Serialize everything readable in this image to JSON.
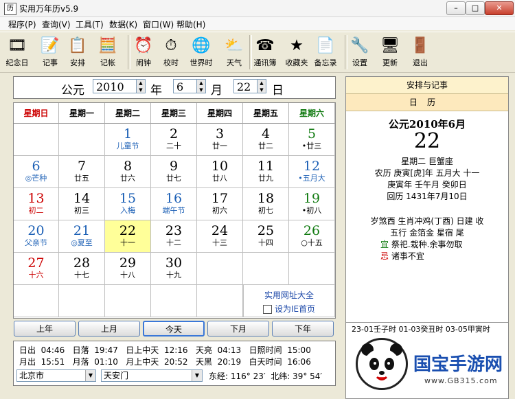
{
  "window": {
    "title": "实用万年历v5.9",
    "icon": "calendar-app-icon",
    "min": "–",
    "max": "□",
    "close": "✕"
  },
  "menu": [
    "程序(P)",
    "查询(V)",
    "工具(T)",
    "数据(K)",
    "窗口(W)",
    "帮助(H)"
  ],
  "toolbar": [
    {
      "label": "纪念日",
      "icon": "film-icon",
      "glyph": "🎞"
    },
    {
      "label": "记事",
      "icon": "notebook-pen-icon",
      "glyph": "📝"
    },
    {
      "label": "安排",
      "icon": "clipboard-icon",
      "glyph": "📋"
    },
    {
      "label": "记帐",
      "icon": "calculator-icon",
      "glyph": "🧮"
    },
    {
      "label": "闹钟",
      "icon": "alarm-clock-icon",
      "glyph": "⏰"
    },
    {
      "label": "校时",
      "icon": "stopwatch-icon",
      "glyph": "⏱"
    },
    {
      "label": "世界时",
      "icon": "globe-icon",
      "glyph": "🌐"
    },
    {
      "label": "天气",
      "icon": "weather-icon",
      "glyph": "⛅"
    },
    {
      "label": "通讯簿",
      "icon": "phone-icon",
      "glyph": "☎"
    },
    {
      "label": "收藏夹",
      "icon": "star-icon",
      "glyph": "★"
    },
    {
      "label": "备忘录",
      "icon": "memo-icon",
      "glyph": "📄"
    },
    {
      "label": "设置",
      "icon": "tools-icon",
      "glyph": "🔧"
    },
    {
      "label": "更新",
      "icon": "update-icon",
      "glyph": "🖥"
    },
    {
      "label": "退出",
      "icon": "exit-door-icon",
      "glyph": "🚪"
    }
  ],
  "date_selector": {
    "era": "公元",
    "year": "2010",
    "year_unit": "年",
    "month": "6",
    "month_unit": "月",
    "day": "22",
    "day_unit": "日"
  },
  "calendar": {
    "weekdays": [
      "星期日",
      "星期一",
      "星期二",
      "星期三",
      "星期四",
      "星期五",
      "星期六"
    ],
    "weekday_colors": [
      "#cc0000",
      "#000000",
      "#000000",
      "#000000",
      "#000000",
      "#000000",
      "#107a10"
    ],
    "rows": [
      [
        null,
        null,
        {
          "d": "1",
          "s": "儿童节",
          "c": "c-blu",
          "sc": "c-blu"
        },
        {
          "d": "2",
          "s": "二十",
          "c": "c-blk"
        },
        {
          "d": "3",
          "s": "廿一",
          "c": "c-blk"
        },
        {
          "d": "4",
          "s": "廿二",
          "c": "c-blk"
        },
        {
          "d": "5",
          "s": "•廿三",
          "c": "c-grn"
        }
      ],
      [
        {
          "d": "6",
          "s": "◎芒种",
          "c": "c-blu",
          "sc": "c-blu"
        },
        {
          "d": "7",
          "s": "廿五",
          "c": "c-blk"
        },
        {
          "d": "8",
          "s": "廿六",
          "c": "c-blk"
        },
        {
          "d": "9",
          "s": "廿七",
          "c": "c-blk"
        },
        {
          "d": "10",
          "s": "廿八",
          "c": "c-blk"
        },
        {
          "d": "11",
          "s": "廿九",
          "c": "c-blk"
        },
        {
          "d": "12",
          "s": "•五月大",
          "c": "c-blu",
          "sc": "c-blu"
        }
      ],
      [
        {
          "d": "13",
          "s": "初二",
          "c": "c-red",
          "sc": "c-red"
        },
        {
          "d": "14",
          "s": "初三",
          "c": "c-blk"
        },
        {
          "d": "15",
          "s": "入梅",
          "c": "c-blu",
          "sc": "c-blu"
        },
        {
          "d": "16",
          "s": "端午节",
          "c": "c-blu",
          "sc": "c-blu"
        },
        {
          "d": "17",
          "s": "初六",
          "c": "c-blk"
        },
        {
          "d": "18",
          "s": "初七",
          "c": "c-blk"
        },
        {
          "d": "19",
          "s": "•初八",
          "c": "c-grn"
        }
      ],
      [
        {
          "d": "20",
          "s": "父亲节",
          "c": "c-blu",
          "sc": "c-blu"
        },
        {
          "d": "21",
          "s": "◎夏至",
          "c": "c-blu",
          "sc": "c-blu"
        },
        {
          "d": "22",
          "s": "十一",
          "c": "c-blk",
          "today": true
        },
        {
          "d": "23",
          "s": "十二",
          "c": "c-blk"
        },
        {
          "d": "24",
          "s": "十三",
          "c": "c-blk"
        },
        {
          "d": "25",
          "s": "十四",
          "c": "c-blk"
        },
        {
          "d": "26",
          "s": "○十五",
          "c": "c-grn"
        }
      ],
      [
        {
          "d": "27",
          "s": "十六",
          "c": "c-red",
          "sc": "c-red"
        },
        {
          "d": "28",
          "s": "十七",
          "c": "c-blk"
        },
        {
          "d": "29",
          "s": "十八",
          "c": "c-blk"
        },
        {
          "d": "30",
          "s": "十九",
          "c": "c-blk"
        },
        null,
        null,
        null
      ],
      [
        null,
        null,
        null,
        null,
        null,
        null,
        null
      ]
    ],
    "links": {
      "site": "实用网址大全",
      "homepage": "设为IE首页"
    }
  },
  "nav": {
    "prev_year": "上年",
    "prev_month": "上月",
    "today": "今天",
    "next_month": "下月",
    "next_year": "下年"
  },
  "sun_moon": {
    "row1": "日出  04:46   日落  19:47   日上中天  12:16   天亮  04:13   日照时间  15:00",
    "row2": "月出  15:51   月落  01:10   月上中天  20:52   天黑  20:19   白天时间  16:06",
    "city": "北京市",
    "district": "天安门",
    "longitude": "东经: 116° 23′  北纬: 39° 54′"
  },
  "right_panel": {
    "title": "安排与记事",
    "tab": "日历",
    "year_month": "公元2010年6月",
    "day": "22",
    "line1": "星期二  巨蟹座",
    "line2": "农历  庚寅[虎]年  五月大  十一",
    "line3": "庚寅年  壬午月  癸卯日",
    "line4": "回历  1431年7月10日",
    "line5": "岁煞西  生肖冲鸡(丁酉)  日建  收",
    "line6": "五行  金箔金      星宿  尾",
    "yi_label": "宜",
    "yi": "  祭祀.栽种.余事勿取",
    "ji_label": "忌",
    "ji": "  诸事不宜",
    "hours": "23-01壬子时  01-03癸丑时  03-05甲寅时"
  },
  "watermark": {
    "text": "国宝手游网",
    "url": "www.GB315.com",
    "icon": "panda-logo-icon"
  },
  "colors": {
    "today": "#ffff99",
    "sunday": "#cc0000",
    "saturday": "#107a10",
    "holiday": "#1b5fb5"
  }
}
